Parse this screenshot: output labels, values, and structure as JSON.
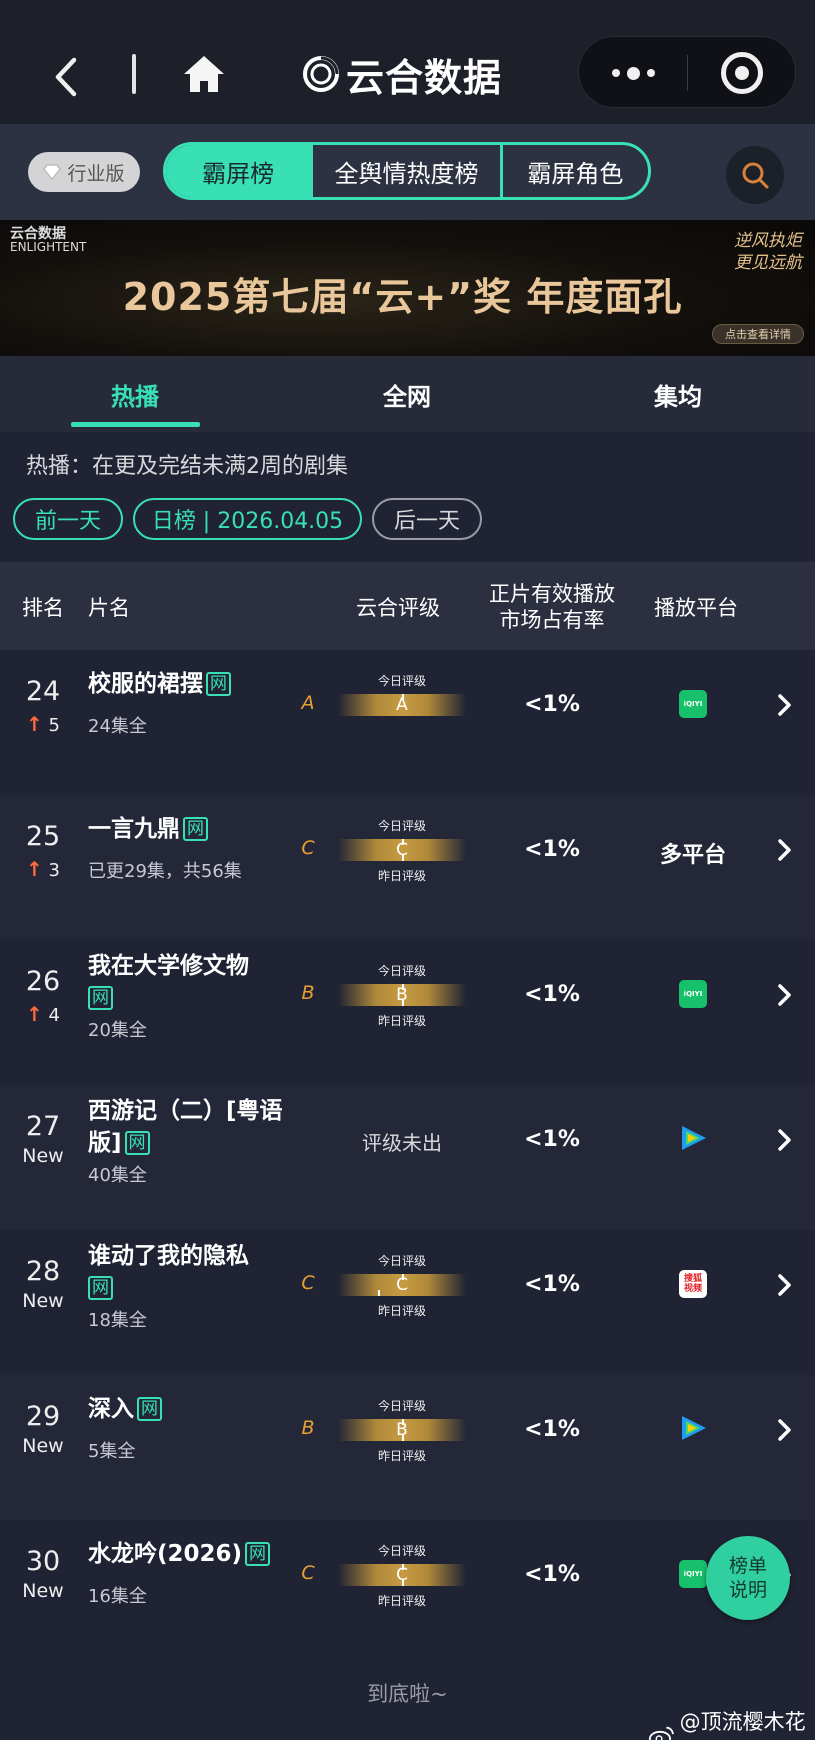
{
  "app": {
    "title": "云合数据"
  },
  "nav": {
    "edition_badge": "行业版",
    "tabs": [
      "霸屏榜",
      "全舆情热度榜",
      "霸屏角色"
    ]
  },
  "banner": {
    "logo": "云合数据",
    "logo_sub": "ENLIGHTENT",
    "title": "2025第七届“云+”奖  年度面孔",
    "slogan": "逆风执炬 更见远航",
    "cta": "点击查看详情"
  },
  "sub_tabs": [
    "热播",
    "全网",
    "集均"
  ],
  "description": "热播：在更及完结未满2周的剧集",
  "date_nav": {
    "prev": "前一天",
    "current": "日榜 | 2026.04.05",
    "next": "后一天"
  },
  "table": {
    "headers": {
      "rank": "排名",
      "title": "片名",
      "grade": "云合评级",
      "share_line1": "正片有效播放",
      "share_line2": "市场占有率",
      "platform": "播放平台"
    },
    "rows": [
      {
        "rank": "24",
        "change": "5",
        "title": "校服的裙摆",
        "tag": "网",
        "episodes": "24集全",
        "grade_letter": "A",
        "today_label": "今日评级",
        "today_grade": "A",
        "yesterday_label": "",
        "share": "<1%",
        "platform": "iqiyi"
      },
      {
        "rank": "25",
        "change": "3",
        "title": "一言九鼎",
        "tag": "网",
        "episodes": "已更29集，共56集",
        "grade_letter": "C",
        "today_label": "今日评级",
        "today_grade": "C",
        "yesterday_label": "昨日评级",
        "share": "<1%",
        "platform_text": "多平台"
      },
      {
        "rank": "26",
        "change": "4",
        "title": "我在大学修文物",
        "tag": "网",
        "episodes": "20集全",
        "grade_letter": "B",
        "today_label": "今日评级",
        "today_grade": "B",
        "yesterday_label": "昨日评级",
        "share": "<1%",
        "platform": "iqiyi"
      },
      {
        "rank": "27",
        "change": "New",
        "title": "西游记（二）[粤语版]",
        "tag": "网",
        "episodes": "40集全",
        "no_rating": "评级未出",
        "share": "<1%",
        "platform": "tencent"
      },
      {
        "rank": "28",
        "change": "New",
        "title": "谁动了我的隐私",
        "tag": "网",
        "episodes": "18集全",
        "grade_letter": "C",
        "today_label": "今日评级",
        "today_grade": "C",
        "yesterday_label": "昨日评级",
        "share": "<1%",
        "platform": "sohu"
      },
      {
        "rank": "29",
        "change": "New",
        "title": "深入",
        "tag": "网",
        "episodes": "5集全",
        "grade_letter": "B",
        "today_label": "今日评级",
        "today_grade": "B",
        "yesterday_label": "昨日评级",
        "share": "<1%",
        "platform": "tencent"
      },
      {
        "rank": "30",
        "change": "New",
        "title": "水龙吟(2026)",
        "tag": "网",
        "episodes": "16集全",
        "grade_letter": "C",
        "today_label": "今日评级",
        "today_grade": "C",
        "yesterday_label": "昨日评级",
        "share": "<1%",
        "platform": "iqiyi"
      }
    ]
  },
  "platform_icons": {
    "iqiyi": "iQIYI",
    "sohu_top": "搜狐",
    "sohu_bottom": "视频"
  },
  "footer": "到底啦~",
  "fab": {
    "line1": "榜单",
    "line2": "说明"
  },
  "watermark": "@顶流樱木花道",
  "colors": {
    "accent": "#38e0b4",
    "up_arrow": "#ff6a3d",
    "grade": "#e8a030",
    "background": "#1f2333"
  }
}
